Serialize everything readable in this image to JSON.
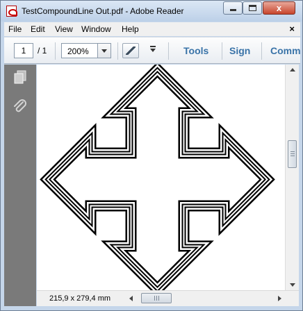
{
  "window": {
    "title": "TestCompoundLine Out.pdf - Adobe Reader",
    "close_glyph": "x"
  },
  "menubar": {
    "items": [
      "File",
      "Edit",
      "View",
      "Window",
      "Help"
    ],
    "close_glyph": "×"
  },
  "toolbar": {
    "page_current": "1",
    "page_total": "/ 1",
    "zoom": "200%",
    "tools_label": "Tools",
    "sign_label": "Sign",
    "comment_label": "Comm"
  },
  "statusbar": {
    "page_size": "215,9 x 279,4 mm"
  },
  "icons": {
    "app": "pdf-document-icon",
    "pages": "pages-icon",
    "attachments": "paperclip-icon",
    "fit": "fit-page-icon"
  },
  "colors": {
    "link": "#3973a8",
    "nav_pane": "#7a7a7a",
    "titlebar": "#c5d6ea"
  }
}
